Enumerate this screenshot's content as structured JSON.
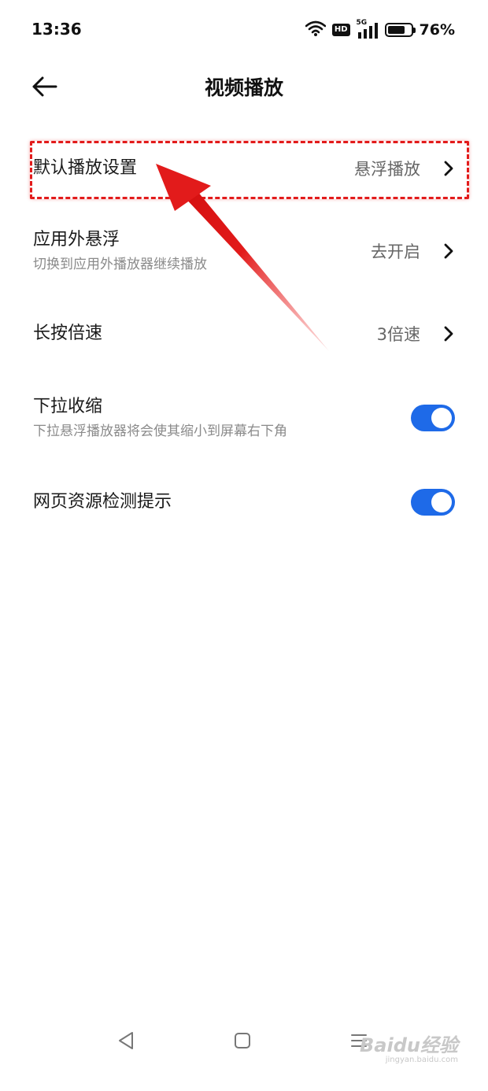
{
  "status_bar": {
    "time": "13:36",
    "hd_label": "HD",
    "network_label": "5G",
    "battery_percent_text": "76%",
    "battery_level": 0.76
  },
  "header": {
    "title": "视频播放"
  },
  "settings": [
    {
      "title": "默认播放设置",
      "value": "悬浮播放",
      "control": "chevron"
    },
    {
      "title": "应用外悬浮",
      "subtitle": "切换到应用外播放器继续播放",
      "value": "去开启",
      "control": "chevron"
    },
    {
      "title": "长按倍速",
      "value": "3倍速",
      "control": "chevron"
    },
    {
      "title": "下拉收缩",
      "subtitle": "下拉悬浮播放器将会使其缩小到屏幕右下角",
      "control": "toggle",
      "enabled": true
    },
    {
      "title": "网页资源检测提示",
      "control": "toggle",
      "enabled": true
    }
  ],
  "watermark": {
    "brand": "Baidu经验",
    "url": "jingyan.baidu.com"
  },
  "colors": {
    "accent": "#1e6ae8",
    "annotation": "#e21b1b",
    "text_primary": "#1a1a1a",
    "text_secondary": "#8a8a8a",
    "value_text": "#666666"
  },
  "icons": {
    "back": "arrow-left-icon",
    "chevron": "chevron-right-icon",
    "wifi": "wifi-icon",
    "signal": "signal-icon",
    "battery": "battery-icon",
    "nav_back": "triangle-back-icon",
    "nav_home": "square-home-icon",
    "nav_menu": "menu-lines-icon"
  }
}
